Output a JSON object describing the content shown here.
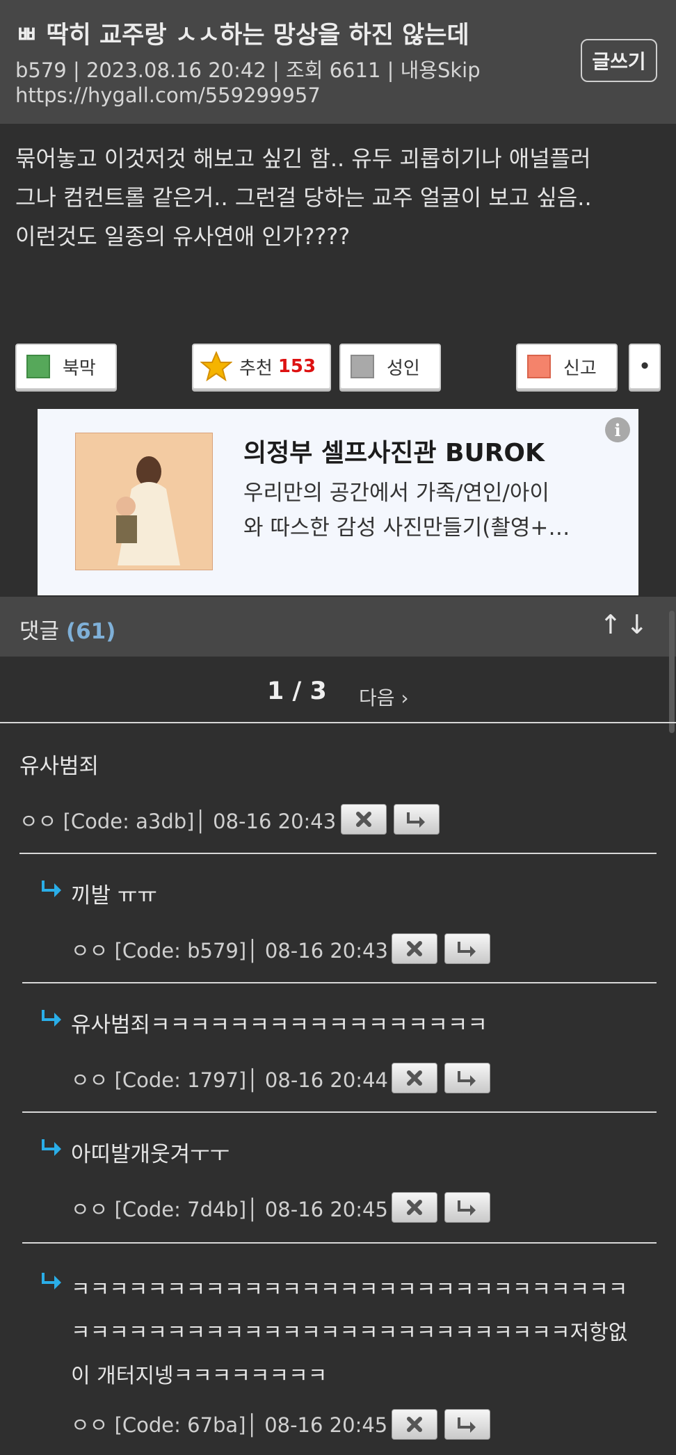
{
  "post": {
    "title": "ㅃ 딱히 교주랑 ㅅㅅ하는 망상을 하진 않는데",
    "meta": "b579 | 2023.08.16 20:42 | 조회 6611 | 내용Skip",
    "url": "https://hygall.com/559299957",
    "body_lines": [
      "묶어놓고 이것저것 해보고 싶긴 함.. 유두 괴롭히기나 애널플러",
      "그나 컴컨트롤 같은거.. 그런걸 당하는 교주 얼굴이 보고 싶음..",
      "이런것도 일종의 유사연애 인가????"
    ]
  },
  "header": {
    "write_button": "글쓰기"
  },
  "actions": {
    "bookmark": "북막",
    "recommend": "추천",
    "recommend_count": "153",
    "adult": "성인",
    "report": "신고",
    "more": "•"
  },
  "ad": {
    "title": "의정부 셀프사진관 BUROK",
    "desc_line1": "우리만의 공간에서 가족/연인/아이",
    "desc_line2": "와 따스한 감성 사진만들기(촬영+…",
    "info": "i"
  },
  "comments_header": {
    "label": "댓글",
    "count": "(61)",
    "sort_icons": "↑↓"
  },
  "pagination": {
    "page": "1 / 3",
    "next": "다음 ›"
  },
  "comments": [
    {
      "text": "유사범죄",
      "meta": "ㅇㅇ [Code: a3db]│ 08-16 20:43",
      "reply": false
    },
    {
      "text": "끼발 ㅠㅠ",
      "meta": "ㅇㅇ [Code: b579]│ 08-16 20:43",
      "reply": true
    },
    {
      "text": "유사범죄ㅋㅋㅋㅋㅋㅋㅋㅋㅋㅋㅋㅋㅋㅋㅋㅋㅋ",
      "meta": "ㅇㅇ [Code: 1797]│ 08-16 20:44",
      "reply": true
    },
    {
      "text": "아띠발개웃겨ㅜㅜ",
      "meta": "ㅇㅇ [Code: 7d4b]│ 08-16 20:45",
      "reply": true
    },
    {
      "text_lines": [
        "ㅋㅋㅋㅋㅋㅋㅋㅋㅋㅋㅋㅋㅋㅋㅋㅋㅋㅋㅋㅋㅋㅋㅋㅋㅋㅋㅋㅋㅋ",
        "ㅋㅋㅋㅋㅋㅋㅋㅋㅋㅋㅋㅋㅋㅋㅋㅋㅋㅋㅋㅋㅋㅋㅋㅋㅋㅋ저항없",
        "이 개터지넹ㅋㅋㅋㅋㅋㅋㅋㅋ"
      ],
      "meta": "ㅇㅇ [Code: 67ba]│ 08-16 20:45",
      "reply": true
    }
  ],
  "colors": {
    "header_bg": "#474747",
    "page_bg": "#2f2f2f",
    "accent_count": "#7fb0d8",
    "recommend_count": "#dd1111",
    "reply_arrow": "#2aaee8",
    "bookmark_green": "#56a85a",
    "adult_gray": "#a9a9a9",
    "report_salmon": "#f4836b"
  }
}
